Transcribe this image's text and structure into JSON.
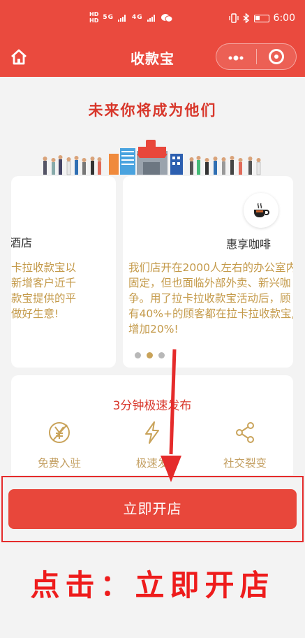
{
  "status_bar": {
    "network_left": "HD 1 / HD 2",
    "signal_1": "5G",
    "signal_2": "4G",
    "time": "6:00"
  },
  "header": {
    "title": "收款宝",
    "home_icon": "home-icon",
    "more_icon": "more-dots-icon",
    "close_icon": "target-close-icon"
  },
  "headline": "未来你将成为他们",
  "stories": [
    {
      "name": "酒店",
      "lines": [
        "卡拉收款宝以",
        "新增客户近千",
        "款宝提供的平",
        "做好生意!"
      ]
    },
    {
      "name": "惠享咖啡",
      "icon": "coffee-icon",
      "lines": [
        "我们店开在2000人左右的办公室内",
        "固定，但也面临外部外卖、新兴咖",
        "争。用了拉卡拉收款宝活动后，顾",
        "有40%+的顾客都在拉卡拉收款宝,",
        "增加20%!"
      ]
    }
  ],
  "carousel": {
    "page_count": 3,
    "active_index": 1
  },
  "feature": {
    "title": "3分钟极速发布",
    "items": [
      {
        "label": "免费入驻",
        "icon": "yuan-circle-icon"
      },
      {
        "label": "极速发",
        "icon": "lightning-icon"
      },
      {
        "label": "社交裂变",
        "icon": "share-icon"
      }
    ]
  },
  "cta": {
    "label": "立即开店"
  },
  "annotation": "点击：立即开店",
  "colors": {
    "brand_red": "#ea4a3e",
    "gold": "#c9a35a",
    "annotation_red": "#ee1c1c"
  }
}
